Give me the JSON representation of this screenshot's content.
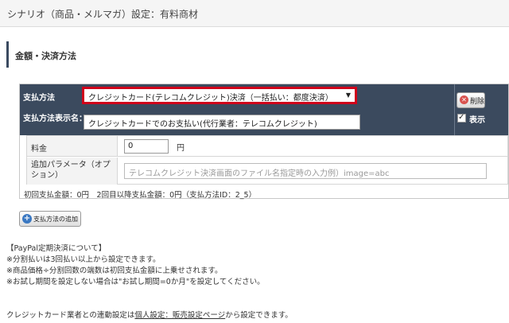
{
  "header": {
    "title": "シナリオ（商品・メルマガ）設定：有料商材"
  },
  "section": {
    "title": "金額・決済方法"
  },
  "payment": {
    "method_label": "支払方法",
    "method_value": "クレジットカード(テレコムクレジット)決済（一括払い：都度決済）",
    "display_name_label": "支払方法表示名：",
    "display_name_value": "クレジットカードでのお支払い(代行業者：テレコムクレジット)",
    "delete_label": "削除",
    "show_label": "表示",
    "show_checked": true,
    "price_label": "料金",
    "price_value": "0",
    "price_unit": "円",
    "param_label": "追加パラメータ（オプション）",
    "param_placeholder": "テレコムクレジット決済画面のファイル名指定時の入力例）image=abc",
    "summary": "初回支払金額：0円　2回目以降支払金額：0円（支払方法ID：2_5）"
  },
  "add_button": {
    "label": "支払方法の追加"
  },
  "notes": {
    "title": "【PayPal定期決済について】",
    "line1": "※分割払いは3回払い以上から設定できます。",
    "line2": "※商品価格÷分割回数の端数は初回支払金額に上乗せされます。",
    "line3": "※お試し期間を設定しない場合は\"お試し期間=0か月\"を設定してください。"
  },
  "footer": {
    "prefix": "クレジットカード業者との連動設定は",
    "link": "個人設定：販売設定ページ",
    "suffix": "から設定できます。"
  }
}
